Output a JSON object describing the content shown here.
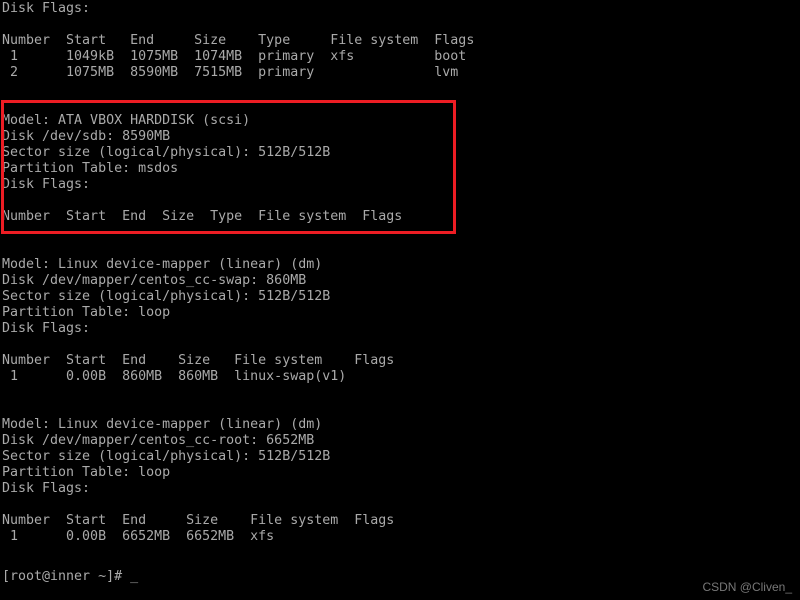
{
  "terminal": {
    "background_color": "#000000",
    "text_color": "#aaaaaa",
    "highlight_color": "#ee1d24",
    "watermark": "CSDN @Cliven_",
    "prompt": "[root@inner ~]# ",
    "cursor": "_",
    "output": "Disk Flags:\n\nNumber  Start   End     Size    Type     File system  Flags\n 1      1049kB  1075MB  1074MB  primary  xfs          boot\n 2      1075MB  8590MB  7515MB  primary               lvm\n\n\nModel: ATA VBOX HARDDISK (scsi)\nDisk /dev/sdb: 8590MB\nSector size (logical/physical): 512B/512B\nPartition Table: msdos\nDisk Flags:\n\nNumber  Start  End  Size  Type  File system  Flags\n\n\nModel: Linux device-mapper (linear) (dm)\nDisk /dev/mapper/centos_cc-swap: 860MB\nSector size (logical/physical): 512B/512B\nPartition Table: loop\nDisk Flags:\n\nNumber  Start  End    Size   File system    Flags\n 1      0.00B  860MB  860MB  linux-swap(v1)\n\n\nModel: Linux device-mapper (linear) (dm)\nDisk /dev/mapper/centos_cc-root: 6652MB\nSector size (logical/physical): 512B/512B\nPartition Table: loop\nDisk Flags:\n\nNumber  Start  End     Size    File system  Flags\n 1      0.00B  6652MB  6652MB  xfs\n",
    "sections": [
      {
        "name": "partial-first-disk",
        "disk_flags_label": "Disk Flags:",
        "table": {
          "headers": [
            "Number",
            "Start",
            "End",
            "Size",
            "Type",
            "File system",
            "Flags"
          ],
          "rows": [
            [
              "1",
              "1049kB",
              "1075MB",
              "1074MB",
              "primary",
              "xfs",
              "boot"
            ],
            [
              "2",
              "1075MB",
              "8590MB",
              "7515MB",
              "primary",
              "",
              "lvm"
            ]
          ]
        }
      },
      {
        "name": "ata-vbox-harddisk-sdb",
        "highlighted": true,
        "model": "Model: ATA VBOX HARDDISK (scsi)",
        "disk": "Disk /dev/sdb: 8590MB",
        "sector_size": "Sector size (logical/physical): 512B/512B",
        "partition_table": "Partition Table: msdos",
        "disk_flags_label": "Disk Flags:",
        "table": {
          "headers": [
            "Number",
            "Start",
            "End",
            "Size",
            "Type",
            "File system",
            "Flags"
          ],
          "rows": []
        }
      },
      {
        "name": "centos-cc-swap",
        "highlighted": false,
        "model": "Model: Linux device-mapper (linear) (dm)",
        "disk": "Disk /dev/mapper/centos_cc-swap: 860MB",
        "sector_size": "Sector size (logical/physical): 512B/512B",
        "partition_table": "Partition Table: loop",
        "disk_flags_label": "Disk Flags:",
        "table": {
          "headers": [
            "Number",
            "Start",
            "End",
            "Size",
            "File system",
            "Flags"
          ],
          "rows": [
            [
              "1",
              "0.00B",
              "860MB",
              "860MB",
              "linux-swap(v1)",
              ""
            ]
          ]
        }
      },
      {
        "name": "centos-cc-root",
        "highlighted": false,
        "model": "Model: Linux device-mapper (linear) (dm)",
        "disk": "Disk /dev/mapper/centos_cc-root: 6652MB",
        "sector_size": "Sector size (logical/physical): 512B/512B",
        "partition_table": "Partition Table: loop",
        "disk_flags_label": "Disk Flags:",
        "table": {
          "headers": [
            "Number",
            "Start",
            "End",
            "Size",
            "File system",
            "Flags"
          ],
          "rows": [
            [
              "1",
              "0.00B",
              "6652MB",
              "6652MB",
              "xfs",
              ""
            ]
          ]
        }
      }
    ]
  }
}
